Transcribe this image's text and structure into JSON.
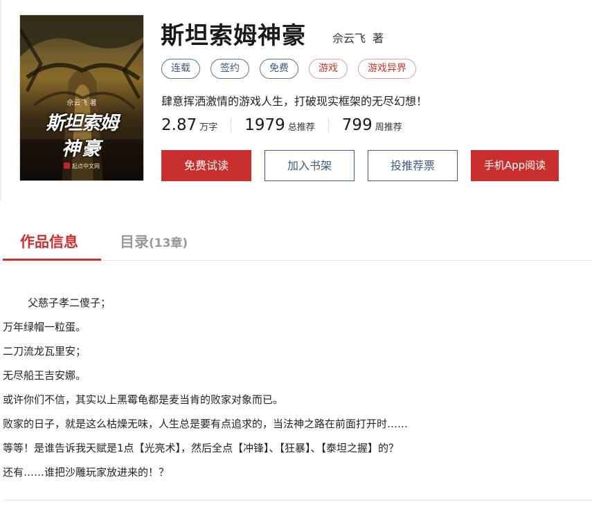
{
  "book": {
    "title": "斯坦索姆神豪",
    "author": "佘云飞",
    "author_suffix": "著",
    "tags": [
      {
        "label": "连载",
        "style": "blue"
      },
      {
        "label": "签约",
        "style": "blue"
      },
      {
        "label": "免费",
        "style": "blue"
      },
      {
        "label": "游戏",
        "style": "red"
      },
      {
        "label": "游戏异界",
        "style": "red"
      }
    ],
    "intro": "肆意挥洒激情的游戏人生，打破现实框架的无尽幻想！",
    "stats": [
      {
        "value": "2.87",
        "unit": "万字"
      },
      {
        "value": "1979",
        "unit": "总推荐"
      },
      {
        "value": "799",
        "unit": "周推荐"
      }
    ]
  },
  "cover": {
    "author_line": "佘云飞 著",
    "title_line1": "斯坦索姆",
    "title_line2": "神豪",
    "publisher_logo": "起点中文网"
  },
  "actions": {
    "read_free": "免费试读",
    "add_shelf": "加入书架",
    "vote": "投推荐票",
    "app_read": "手机App阅读"
  },
  "tabs": {
    "info": "作品信息",
    "catalog": "目录",
    "catalog_count": "(13章)"
  },
  "synopsis": [
    "父慈子孝二傻子；",
    "万年绿帽一粒蛋。",
    "二刀流龙瓦里安；",
    "无尽船王吉安娜。",
    "或许你们不信，其实以上黑霉龟都是麦当肯的败家对象而已。",
    "败家的日子，就是这么枯燥无味，人生总是要有点追求的，当法神之路在前面打开时……",
    "等等！是谁告诉我天赋是1点【光亮术】，然后全点【冲锋】、【狂暴】、【泰坦之握】的？",
    "还有……谁把沙雕玩家放进来的！？"
  ],
  "colors": {
    "accent_red": "#c7302e",
    "tag_blue": "#3f5b82",
    "muted_gray": "#999999"
  }
}
